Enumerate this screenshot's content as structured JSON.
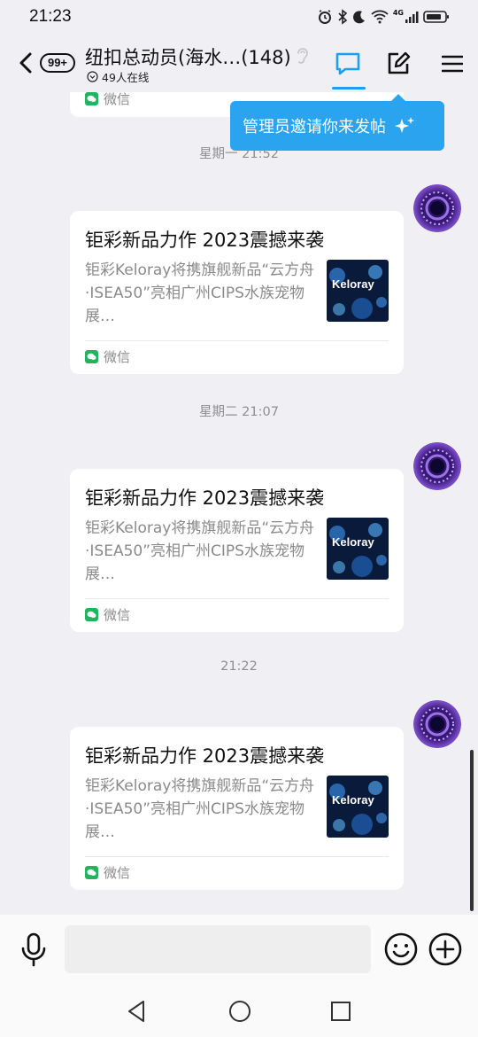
{
  "status": {
    "time": "21:23",
    "network": "4G"
  },
  "header": {
    "unread": "99+",
    "title": "纽扣总动员(海水…(148)",
    "online": "49人在线"
  },
  "tooltip": {
    "text": "管理员邀请你来发帖"
  },
  "partial_card": {
    "source": "微信"
  },
  "timestamps": [
    "星期一 21:52",
    "星期二 21:07",
    "21:22"
  ],
  "cards": [
    {
      "title": "钜彩新品力作 2023震撼来袭",
      "desc": "钜彩Keloray将携旗舰新品“云方舟·ISEA50”亮相广州CIPS水族宠物展…",
      "thumb_text": "Keloray",
      "source": "微信"
    },
    {
      "title": "钜彩新品力作 2023震撼来袭",
      "desc": "钜彩Keloray将携旗舰新品“云方舟·ISEA50”亮相广州CIPS水族宠物展…",
      "thumb_text": "Keloray",
      "source": "微信"
    },
    {
      "title": "钜彩新品力作 2023震撼来袭",
      "desc": "钜彩Keloray将携旗舰新品“云方舟·ISEA50”亮相广州CIPS水族宠物展…",
      "thumb_text": "Keloray",
      "source": "微信"
    }
  ],
  "input": {
    "placeholder": ""
  },
  "icons": {
    "back": "back-arrow-icon",
    "ear": "earpiece-icon",
    "chat": "chat-bubble-icon",
    "post": "edit-post-icon",
    "menu": "menu-icon",
    "mic": "microphone-icon",
    "emoji": "emoji-icon",
    "plus": "plus-icon",
    "nav_back": "nav-back-icon",
    "nav_home": "nav-home-icon",
    "nav_recent": "nav-recent-icon"
  },
  "colors": {
    "accent": "#1aa0f0",
    "tooltip": "#2aa4ef",
    "wechat": "#22b35e",
    "background": "#f0f0f4"
  }
}
